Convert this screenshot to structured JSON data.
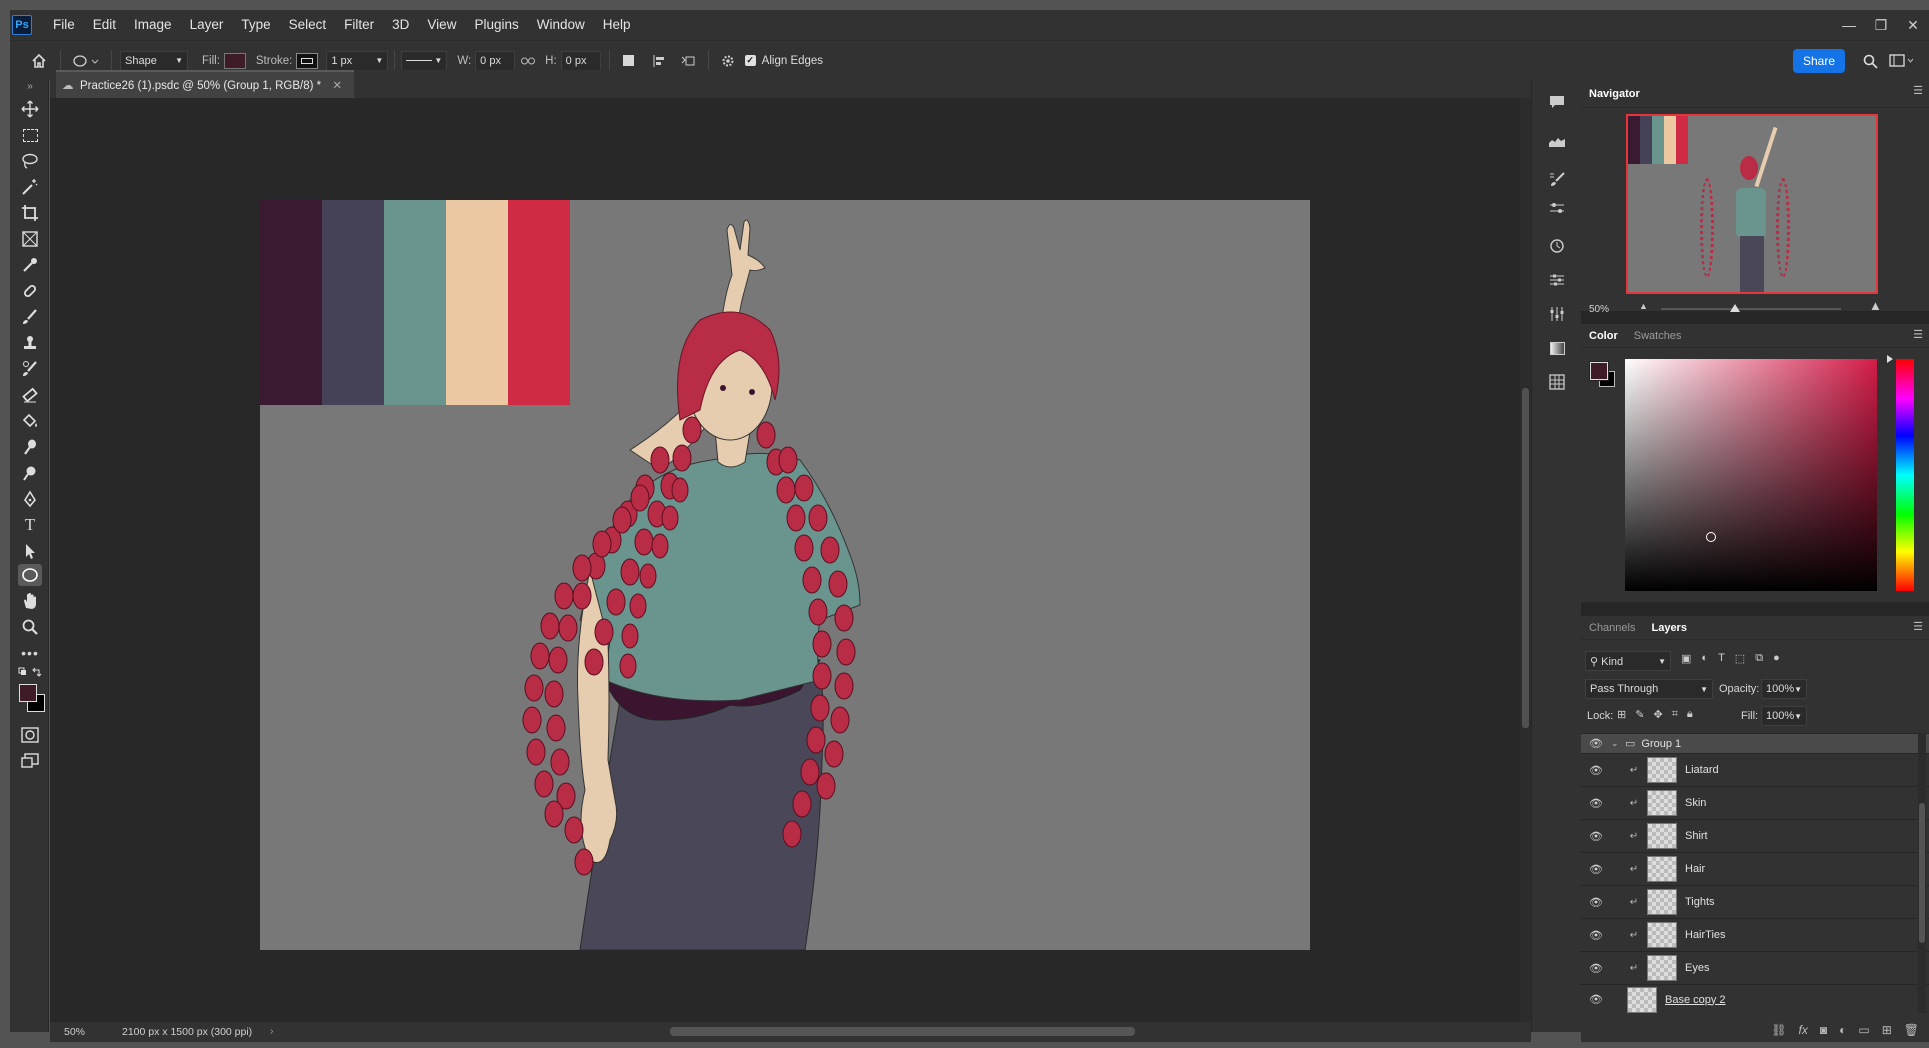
{
  "app": {
    "logo": "Ps"
  },
  "menu": [
    "File",
    "Edit",
    "Image",
    "Layer",
    "Type",
    "Select",
    "Filter",
    "3D",
    "View",
    "Plugins",
    "Window",
    "Help"
  ],
  "window_controls": [
    "—",
    "❐",
    "✕"
  ],
  "options": {
    "mode": "Shape",
    "fill_label": "Fill:",
    "fill_color": "#3d1c27",
    "stroke_label": "Stroke:",
    "stroke_width": "1 px",
    "w_label": "W:",
    "w_value": "0 px",
    "h_label": "H:",
    "h_value": "0 px",
    "align_edges": "Align Edges",
    "share": "Share"
  },
  "document": {
    "tab_title": "Practice26 (1).psdc @ 50% (Group 1, RGB/8) *",
    "zoom": "50%",
    "size_info": "2100 px x 1500 px (300 ppi)"
  },
  "palette": [
    "#3a1a30",
    "#454257",
    "#6a958f",
    "#ecc9a2",
    "#cf2b44"
  ],
  "colors": {
    "background": "#787878",
    "skin": "#e6cdb0",
    "shirt": "#6a958f",
    "hair": "#b82c46",
    "tights": "#4a4858",
    "leotard": "#3b1430",
    "foreground": "#3d1c27",
    "background_swatch": "#000000"
  },
  "navigator": {
    "title": "Navigator",
    "zoom": "50%"
  },
  "color_panel": {
    "tabs": [
      "Color",
      "Swatches"
    ]
  },
  "layers_panel": {
    "tabs": [
      "Channels",
      "Layers"
    ],
    "filter_kind": "Kind",
    "blend_mode": "Pass Through",
    "opacity_label": "Opacity:",
    "opacity_value": "100%",
    "lock_label": "Lock:",
    "fill_label": "Fill:",
    "fill_value": "100%",
    "group_name": "Group 1",
    "layers": [
      {
        "name": "Liatard"
      },
      {
        "name": "Skin"
      },
      {
        "name": "Shirt"
      },
      {
        "name": "Hair"
      },
      {
        "name": "Tights"
      },
      {
        "name": "HairTies"
      },
      {
        "name": "Eyes"
      },
      {
        "name": "Base copy 2"
      }
    ]
  }
}
